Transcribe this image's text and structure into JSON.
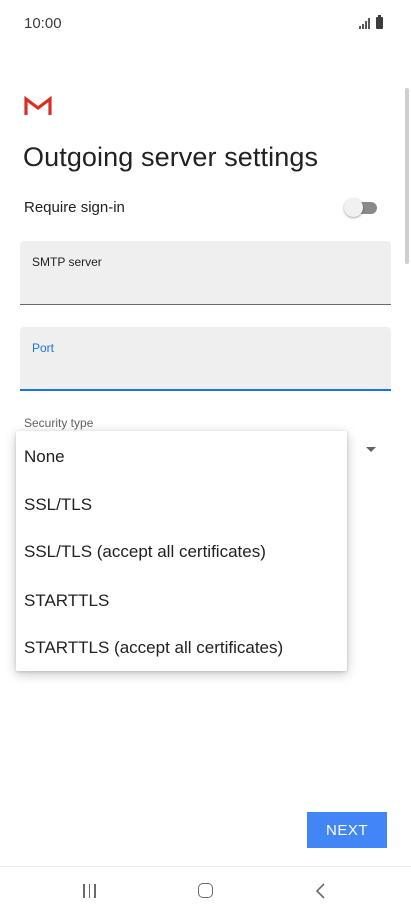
{
  "status_bar": {
    "time": "10:00",
    "icons": [
      "signal-icon",
      "battery-icon"
    ]
  },
  "app": {
    "logo": "gmail-logo",
    "logo_color": "#d93025"
  },
  "page": {
    "title": "Outgoing server settings"
  },
  "require_signin": {
    "label": "Require sign-in",
    "enabled": false
  },
  "fields": {
    "smtp_server": {
      "label": "SMTP server",
      "value": ""
    },
    "port": {
      "label": "Port",
      "value": "",
      "focused": true
    }
  },
  "security_type": {
    "label": "Security type",
    "options": [
      "None",
      "SSL/TLS",
      "SSL/TLS (accept all certificates)",
      "STARTTLS",
      "STARTTLS (accept all certificates)"
    ]
  },
  "actions": {
    "next_label": "NEXT"
  },
  "colors": {
    "accent": "#1a73e8",
    "button": "#4285f4"
  },
  "nav_bar": {
    "icons": [
      "recents-icon",
      "home-icon",
      "back-icon"
    ]
  }
}
